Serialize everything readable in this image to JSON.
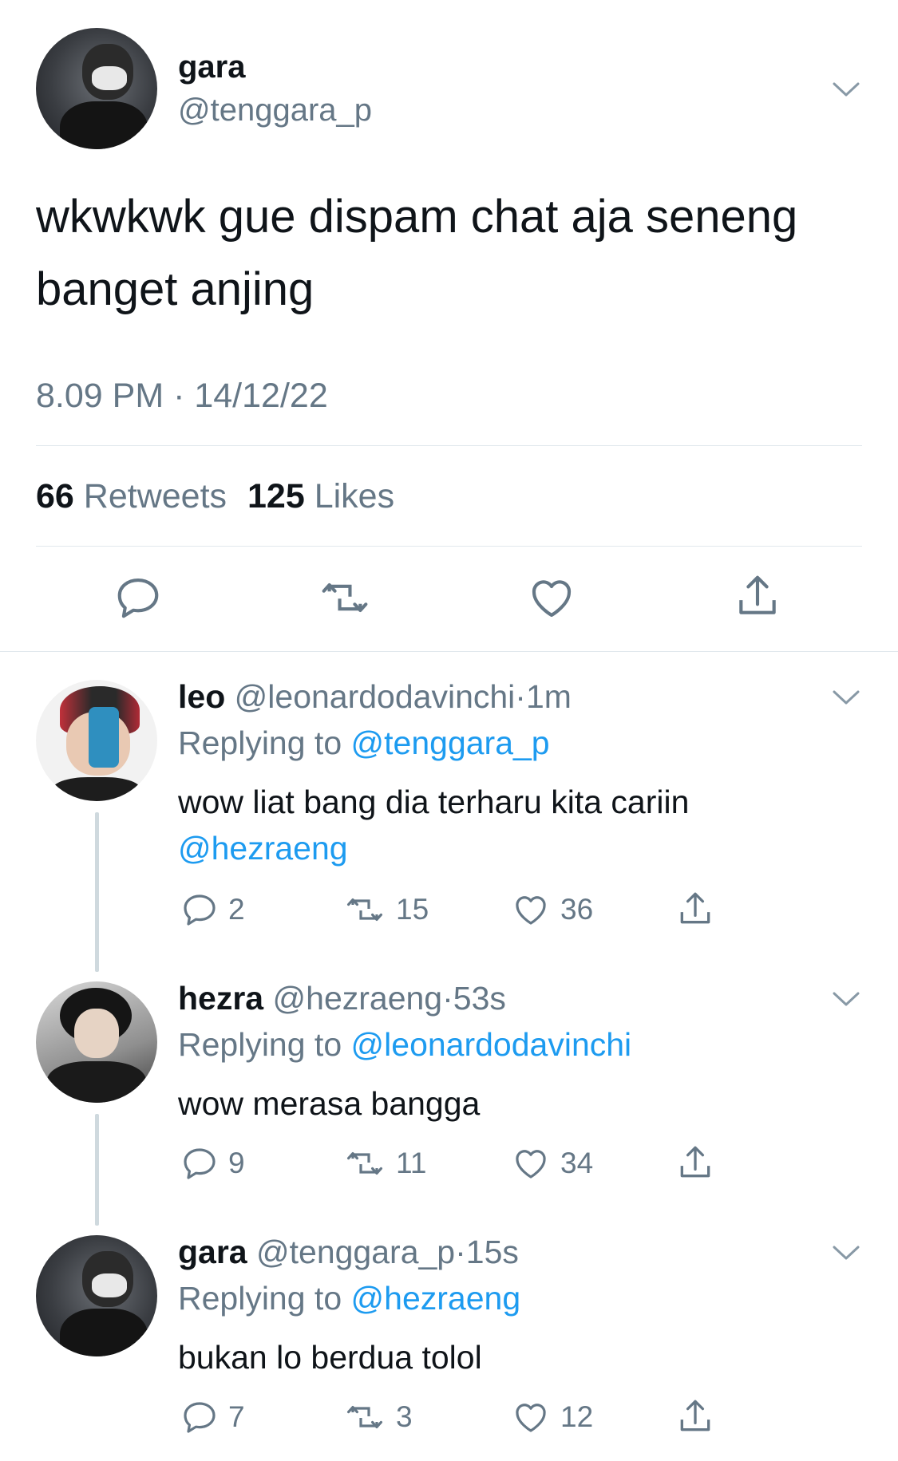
{
  "main_tweet": {
    "display_name": "gara",
    "handle": "@tenggara_p",
    "text_line1": "wkwkwk gue dispam chat aja seneng",
    "text_line2": "banget anjing",
    "timestamp": "8.09 PM · 14/12/22",
    "retweets_count": "66",
    "retweets_label": "Retweets",
    "likes_count": "125",
    "likes_label": "Likes"
  },
  "replies": [
    {
      "display_name": "leo",
      "handle": "@leonardodavinchi",
      "dot": "·",
      "time": "1m",
      "replying_label": "Replying to",
      "replying_to": "@tenggara_p",
      "text_line1": "wow liat bang dia terharu kita cariin",
      "text_line2": "@hezraeng",
      "replies": "2",
      "retweets": "15",
      "likes": "36"
    },
    {
      "display_name": "hezra",
      "handle": "@hezraeng",
      "dot": "·",
      "time": "53s",
      "replying_label": "Replying to",
      "replying_to": "@leonardodavinchi",
      "text_line1": "wow merasa bangga",
      "replies": "9",
      "retweets": "11",
      "likes": "34"
    },
    {
      "display_name": "gara",
      "handle": "@tenggara_p",
      "dot": "·",
      "time": "15s",
      "replying_label": "Replying to",
      "replying_to": "@hezraeng",
      "text_line1": "bukan lo berdua tolol",
      "replies": "7",
      "retweets": "3",
      "likes": "12"
    }
  ],
  "colors": {
    "link": "#1d9bf0",
    "secondary_text": "#657786",
    "icon": "#657786",
    "divider": "#e1e8ed"
  },
  "icons": [
    "chevron-down-icon",
    "reply-icon",
    "retweet-icon",
    "like-icon",
    "share-icon"
  ]
}
